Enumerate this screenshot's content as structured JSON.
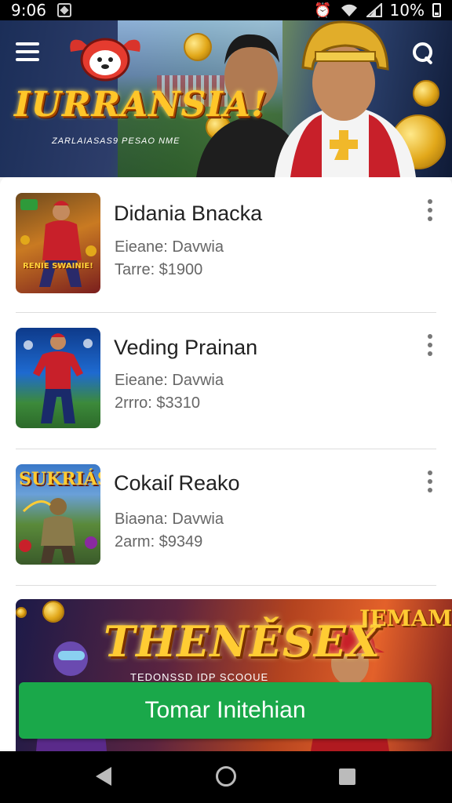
{
  "status_bar": {
    "time": "9:06",
    "battery": "10%",
    "icons": [
      "notification-icon",
      "alarm-icon",
      "wifi-icon",
      "signal-icon",
      "battery-icon"
    ]
  },
  "hero": {
    "title": "IURRANSIA!",
    "subtitle": "ZARLAIASAS9 PESAO NME",
    "icons": [
      "menu-icon",
      "search-icon",
      "mascot-logo"
    ]
  },
  "items": [
    {
      "title": "Didania Bnacka",
      "meta1": "Eieane: Davwia",
      "meta2": "Tarre: $1900",
      "thumb_text": "RENIE SWAINIE!"
    },
    {
      "title": "Veding Prainan",
      "meta1": "Eieane: Davwia",
      "meta2": "2rrro: $3310",
      "thumb_text": ""
    },
    {
      "title": "Cokaiſ Reako",
      "meta1": "Biaəna: Davwia",
      "meta2": "2arm: $9349",
      "thumb_text": "SUKRIÁS"
    }
  ],
  "promo": {
    "title": "THENĚSEX",
    "subtitle": "TEDONSSD IDP SCOOUE",
    "corner": "JEMAMESI"
  },
  "cta": {
    "label": "Tomar Initehian"
  },
  "colors": {
    "accent": "#1aa84a",
    "gold": "#ffc629"
  }
}
